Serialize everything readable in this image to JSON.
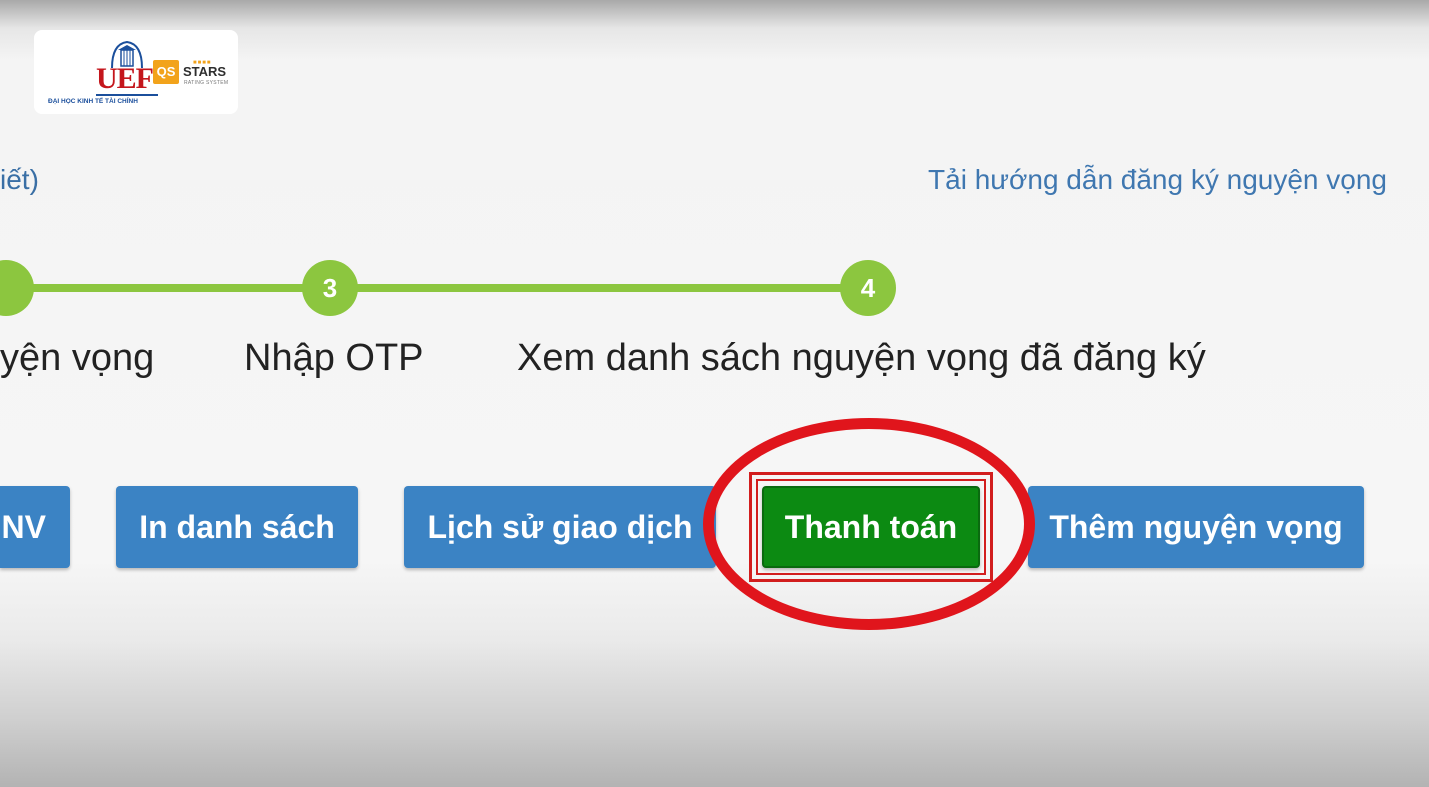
{
  "logo": {
    "uef_text": "UEF",
    "uef_subtitle": "ĐẠI HỌC KINH TẾ TÀI CHÍNH",
    "qs_badge": "QS",
    "qs_stars_text": "STARS",
    "qs_rating_text": "RATING SYSTEM",
    "qs_dots": "■■■■"
  },
  "header": {
    "partial_link": "iết)",
    "guide_link": "Tải hướng dẫn đăng ký nguyện vọng"
  },
  "stepper": {
    "steps": [
      {
        "number": "",
        "label": "yện vọng"
      },
      {
        "number": "3",
        "label": "Nhập OTP"
      },
      {
        "number": "4",
        "label": "Xem danh sách nguyện vọng đã đăng ký"
      }
    ]
  },
  "buttons": {
    "partial": "NV",
    "print_list": "In danh sách",
    "transaction_history": "Lịch sử giao dịch",
    "pay": "Thanh toán",
    "add_wish": "Thêm nguyện vọng"
  },
  "colors": {
    "step_green": "#8cc63f",
    "button_blue": "#3b83c4",
    "pay_green": "#0c8a12",
    "highlight_red": "#e0151c",
    "link_blue": "#3f77b0"
  }
}
